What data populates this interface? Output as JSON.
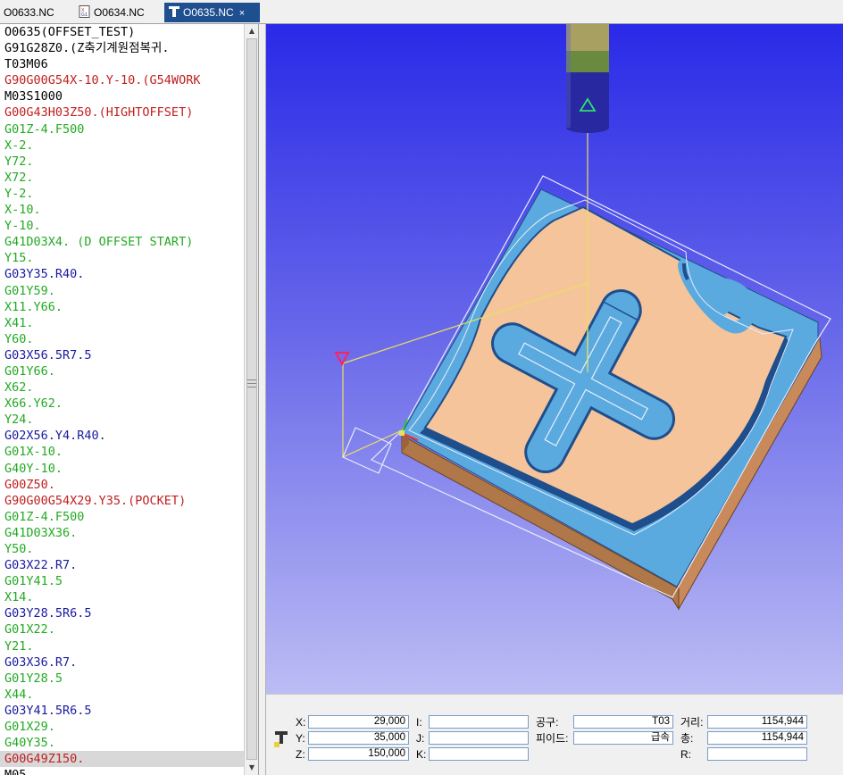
{
  "tabs": [
    {
      "label": "O0633.NC",
      "active": false
    },
    {
      "label": "O0634.NC",
      "active": false
    },
    {
      "label": "O0635.NC",
      "active": true,
      "close": "×"
    }
  ],
  "code_lines": [
    {
      "text": "O0635(OFFSET_TEST)",
      "color": "black"
    },
    {
      "text": "G91G28Z0.(Z축기계원점복귀.",
      "color": "black"
    },
    {
      "text": "T03M06",
      "color": "black"
    },
    {
      "text": "G90G00G54X-10.Y-10.(G54WORK",
      "color": "red"
    },
    {
      "text": "M03S1000",
      "color": "black"
    },
    {
      "text": "G00G43H03Z50.(HIGHTOFFSET)",
      "color": "red"
    },
    {
      "text": "G01Z-4.F500",
      "color": "green"
    },
    {
      "text": "X-2.",
      "color": "green"
    },
    {
      "text": "Y72.",
      "color": "green"
    },
    {
      "text": "X72.",
      "color": "green"
    },
    {
      "text": "Y-2.",
      "color": "green"
    },
    {
      "text": "X-10.",
      "color": "green"
    },
    {
      "text": "Y-10.",
      "color": "green"
    },
    {
      "text": "G41D03X4. (D OFFSET START)",
      "color": "green"
    },
    {
      "text": "Y15.",
      "color": "green"
    },
    {
      "text": "G03Y35.R40.",
      "color": "blue"
    },
    {
      "text": "G01Y59.",
      "color": "green"
    },
    {
      "text": "X11.Y66.",
      "color": "green"
    },
    {
      "text": "X41.",
      "color": "green"
    },
    {
      "text": "Y60.",
      "color": "green"
    },
    {
      "text": "G03X56.5R7.5",
      "color": "blue"
    },
    {
      "text": "G01Y66.",
      "color": "green"
    },
    {
      "text": "X62.",
      "color": "green"
    },
    {
      "text": "X66.Y62.",
      "color": "green"
    },
    {
      "text": "Y24.",
      "color": "green"
    },
    {
      "text": "G02X56.Y4.R40.",
      "color": "blue"
    },
    {
      "text": "G01X-10.",
      "color": "green"
    },
    {
      "text": "G40Y-10.",
      "color": "green"
    },
    {
      "text": "G00Z50.",
      "color": "red"
    },
    {
      "text": "G90G00G54X29.Y35.(POCKET)",
      "color": "red"
    },
    {
      "text": "G01Z-4.F500",
      "color": "green"
    },
    {
      "text": "G41D03X36.",
      "color": "green"
    },
    {
      "text": "Y50.",
      "color": "green"
    },
    {
      "text": "G03X22.R7.",
      "color": "blue"
    },
    {
      "text": "G01Y41.5",
      "color": "green"
    },
    {
      "text": "X14.",
      "color": "green"
    },
    {
      "text": "G03Y28.5R6.5",
      "color": "blue"
    },
    {
      "text": "G01X22.",
      "color": "green"
    },
    {
      "text": "Y21.",
      "color": "green"
    },
    {
      "text": "G03X36.R7.",
      "color": "blue"
    },
    {
      "text": "G01Y28.5",
      "color": "green"
    },
    {
      "text": "X44.",
      "color": "green"
    },
    {
      "text": "G03Y41.5R6.5",
      "color": "blue"
    },
    {
      "text": "G01X29.",
      "color": "green"
    },
    {
      "text": "G40Y35.",
      "color": "green"
    },
    {
      "text": "G00G49Z150.",
      "color": "red",
      "selected": true
    },
    {
      "text": "M05",
      "color": "black"
    }
  ],
  "status": {
    "x_label": "X:",
    "x_value": "29,000",
    "y_label": "Y:",
    "y_value": "35,000",
    "z_label": "Z:",
    "z_value": "150,000",
    "i_label": "I:",
    "i_value": "",
    "j_label": "J:",
    "j_value": "",
    "k_label": "K:",
    "k_value": "",
    "tool_label": "공구:",
    "tool_value": "T03",
    "feed_label": "피이드:",
    "feed_value": "급속",
    "dist_label": "거리:",
    "dist_value": "1154,944",
    "total_label": "총:",
    "total_value": "1154,944",
    "r_label": "R:",
    "r_value": ""
  },
  "colors": {
    "stock_top": "#f5c49b",
    "stock_side": "#c88a5a",
    "cut_blue": "#5aaae0",
    "cut_wall": "#1f4e8c",
    "tool_shank": "#2828a0",
    "tool_tip": "#a8a060",
    "selection": "#d8d8d8"
  },
  "icons": [
    "tool-icon",
    "nc-file-icon",
    "scroll-grip-icon",
    "origin-triangle-icon",
    "tool-triangle-icon"
  ]
}
